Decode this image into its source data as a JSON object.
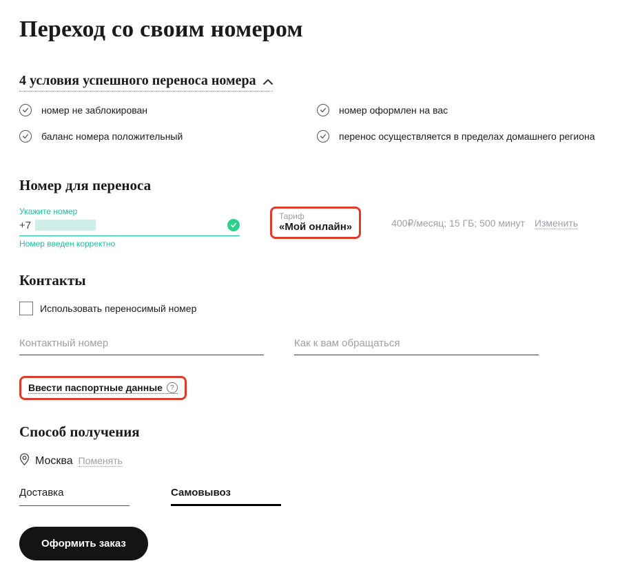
{
  "page_title": "Переход со своим номером",
  "conditions": {
    "header": "4 условия успешного переноса номера",
    "items": [
      "номер не заблокирован",
      "номер оформлен на вас",
      "баланс номера положительный",
      "перенос осуществляется в пределах домашнего региона"
    ]
  },
  "number_section": {
    "title": "Номер для переноса",
    "label": "Укажите номер",
    "prefix": "+7",
    "valid_message": "Номер введен корректно"
  },
  "tariff": {
    "label": "Тариф",
    "name": "«Мой онлайн»",
    "details": "400₽/месяц; 15 ГБ; 500 минут",
    "change": "Изменить"
  },
  "contacts": {
    "title": "Контакты",
    "use_ported_number": "Использовать переносимый номер",
    "phone_placeholder": "Контактный номер",
    "name_placeholder": "Как к вам обращаться"
  },
  "passport": {
    "link": "Ввести паспортные данные"
  },
  "delivery": {
    "title": "Способ получения",
    "city": "Москва",
    "change": "Поменять",
    "tabs": {
      "delivery": "Доставка",
      "pickup": "Самовывоз"
    }
  },
  "submit": "Оформить заказ"
}
